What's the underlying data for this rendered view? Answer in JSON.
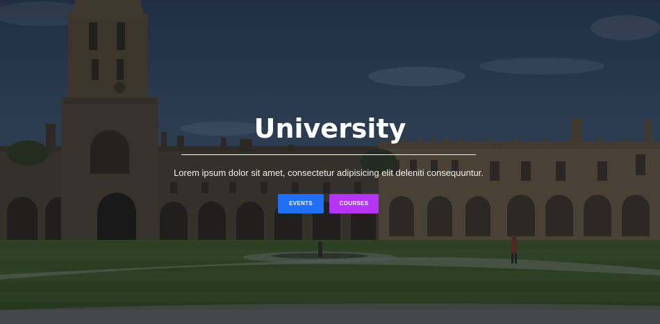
{
  "hero": {
    "title": "University",
    "subtitle": "Lorem ipsum dolor sit amet, consectetur adipisicing elit deleniti consequuntur.",
    "buttons": [
      {
        "label": "EVENTS",
        "color": "#1f6ff7"
      },
      {
        "label": "COURSES",
        "color": "#b535f6"
      }
    ]
  }
}
